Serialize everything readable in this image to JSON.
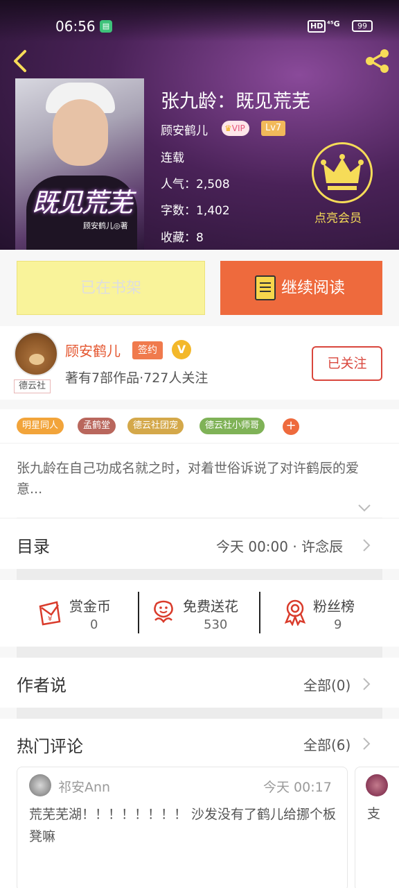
{
  "status_bar": {
    "time": "06:56",
    "hd": "HD",
    "signal": "⁴⁵G",
    "battery": "99"
  },
  "book": {
    "cover_title": "既见荒芜",
    "cover_author": "顾安鹤儿◎著",
    "title": "张九龄：既见荒芜",
    "author": "顾安鹤儿",
    "vip_label": "VIP",
    "level": "Lv7",
    "status": "连载",
    "popularity": "人气：2,508",
    "word_count": "字数：1,402",
    "favorites": "收藏：8"
  },
  "member": {
    "label": "点亮会员"
  },
  "buttons": {
    "shelf": "已在书架",
    "continue_read": "继续阅读"
  },
  "author_card": {
    "avatar_tag": "德云社",
    "name": "顾安鹤儿",
    "sign_badge": "签约",
    "verified": "V",
    "stats": "著有7部作品·727人关注",
    "follow": "已关注"
  },
  "tags": [
    {
      "label": "明星同人",
      "color": "#f2a43a"
    },
    {
      "label": "孟鹤堂",
      "color": "#b9675d"
    },
    {
      "label": "德云社团宠",
      "color": "#d4a84a"
    },
    {
      "label": "德云社小师哥",
      "color": "#7fb257"
    }
  ],
  "tag_add": "+",
  "description": "张九龄在自己功成名就之时，对着世俗诉说了对许鹤辰的爱意...",
  "catalog": {
    "title": "目录",
    "latest": "今天 00:00 · 许念辰"
  },
  "actions": [
    {
      "label": "赏金币",
      "value": "0",
      "icon": "red-envelope-icon"
    },
    {
      "label": "免费送花",
      "value": "530",
      "icon": "flower-icon"
    },
    {
      "label": "粉丝榜",
      "value": "9",
      "icon": "medal-icon"
    }
  ],
  "author_says": {
    "title": "作者说",
    "all": "全部(0)"
  },
  "hot_comments": {
    "title": "热门评论",
    "all": "全部(6)",
    "items": [
      {
        "user": "祁安Ann",
        "time": "今天 00:17",
        "text": "荒芜芜湖！！！！！！！！ 沙发没有了鹤儿给挪个板凳嘛"
      },
      {
        "text": "支"
      }
    ]
  },
  "colors": {
    "accent": "#ee6a3d",
    "shelf_bg": "#f9f39a",
    "gold": "#f6dc58",
    "follow_red": "#d9463c"
  }
}
